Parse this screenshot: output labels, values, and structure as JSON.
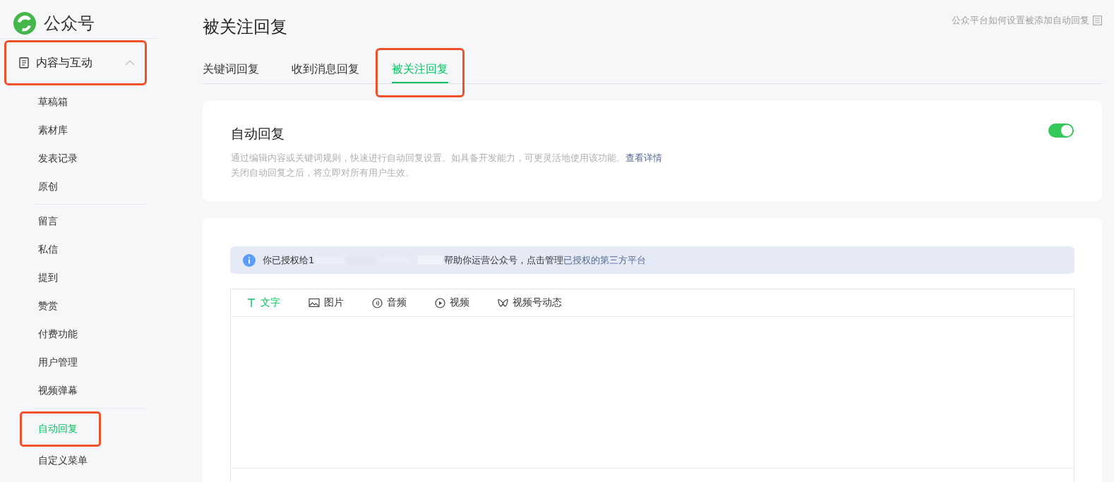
{
  "logo": {
    "text": "公众号"
  },
  "sidebar": {
    "group": {
      "label": "内容与互动",
      "expanded": true,
      "highlighted": true
    },
    "sections": [
      [
        {
          "label": "草稿箱",
          "selected": false,
          "highlighted": false
        },
        {
          "label": "素材库",
          "selected": false,
          "highlighted": false
        },
        {
          "label": "发表记录",
          "selected": false,
          "highlighted": false
        },
        {
          "label": "原创",
          "selected": false,
          "highlighted": false
        }
      ],
      [
        {
          "label": "留言",
          "selected": false,
          "highlighted": false
        },
        {
          "label": "私信",
          "selected": false,
          "highlighted": false
        },
        {
          "label": "提到",
          "selected": false,
          "highlighted": false
        },
        {
          "label": "赞赏",
          "selected": false,
          "highlighted": false
        },
        {
          "label": "付费功能",
          "selected": false,
          "highlighted": false
        },
        {
          "label": "用户管理",
          "selected": false,
          "highlighted": false
        },
        {
          "label": "视频弹幕",
          "selected": false,
          "highlighted": false
        }
      ],
      [
        {
          "label": "自动回复",
          "selected": true,
          "highlighted": true
        },
        {
          "label": "自定义菜单",
          "selected": false,
          "highlighted": false
        }
      ]
    ]
  },
  "page": {
    "title": "被关注回复",
    "help_link": "公众平台如何设置被添加自动回复"
  },
  "tabs": [
    {
      "label": "关键词回复",
      "selected": false,
      "highlighted": false
    },
    {
      "label": "收到消息回复",
      "selected": false,
      "highlighted": false
    },
    {
      "label": "被关注回复",
      "selected": true,
      "highlighted": true
    }
  ],
  "auto_reply": {
    "title": "自动回复",
    "on": true,
    "description": "通过编辑内容或关键词规则，快速进行自动回复设置。如具备开发能力，可更灵活地使用该功能。",
    "details_link": "查看详情",
    "note": "关闭自动回复之后，将立即对所有用户生效。"
  },
  "notice": {
    "before": "你已授权给1",
    "after": "帮助你运营公众号，点击管理",
    "link": "已授权的第三方平台"
  },
  "editor": {
    "types": [
      {
        "kind": "text",
        "label": "文字",
        "selected": true
      },
      {
        "kind": "image",
        "label": "图片",
        "selected": false
      },
      {
        "kind": "audio",
        "label": "音频",
        "selected": false
      },
      {
        "kind": "video",
        "label": "视频",
        "selected": false
      },
      {
        "kind": "channels",
        "label": "视频号动态",
        "selected": false
      }
    ]
  }
}
